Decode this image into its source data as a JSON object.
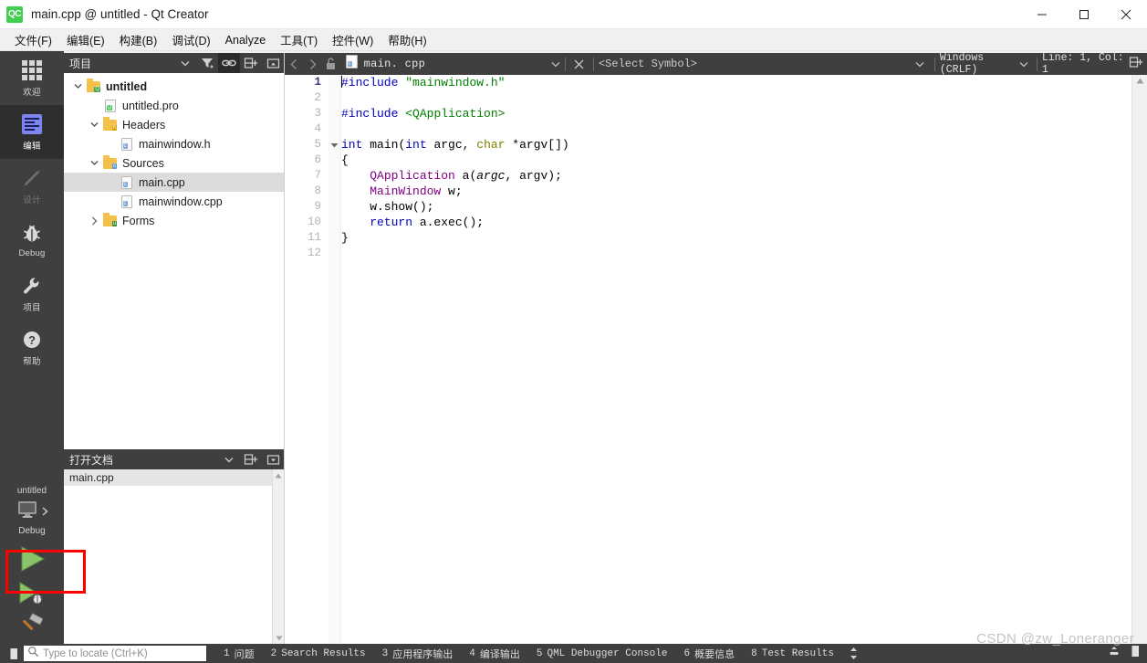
{
  "window": {
    "logo": "qtcreator-logo",
    "title": "main.cpp @ untitled - Qt Creator",
    "minimize": "minimize-icon",
    "maximize": "maximize-icon",
    "close": "close-icon"
  },
  "menubar": {
    "items": [
      {
        "label": "文件(F)",
        "mnemonic": "F"
      },
      {
        "label": "编辑(E)",
        "mnemonic": "E"
      },
      {
        "label": "构建(B)",
        "mnemonic": "B"
      },
      {
        "label": "调试(D)",
        "mnemonic": "D"
      },
      {
        "label": "Analyze",
        "mnemonic": "A"
      },
      {
        "label": "工具(T)",
        "mnemonic": "T"
      },
      {
        "label": "控件(W)",
        "mnemonic": "W"
      },
      {
        "label": "帮助(H)",
        "mnemonic": "H"
      }
    ]
  },
  "modebar": {
    "items": [
      {
        "label": "欢迎",
        "icon": "grid-icon",
        "state": "normal"
      },
      {
        "label": "编辑",
        "icon": "edit-lines-icon",
        "state": "active"
      },
      {
        "label": "设计",
        "icon": "pencil-icon",
        "state": "disabled"
      },
      {
        "label": "Debug",
        "icon": "bug-icon",
        "state": "normal"
      },
      {
        "label": "项目",
        "icon": "wrench-icon",
        "state": "normal"
      },
      {
        "label": "帮助",
        "icon": "question-mark-icon",
        "state": "normal"
      }
    ]
  },
  "kitselector": {
    "project": "untitled",
    "build_config": "Debug",
    "monitor_icon": "monitor-icon",
    "expand_icon": "chevron-right-icon",
    "run_button": "run-green-play-icon",
    "debug_button": "debug-run-icon",
    "build_button": "hammer-build-icon",
    "highlight_color": "#ff0000"
  },
  "project_panel": {
    "title": "项目",
    "tools": [
      {
        "name": "dropdown-icon",
        "label": "▾"
      },
      {
        "name": "filter-icon",
        "label": "filter"
      },
      {
        "name": "link-sync-icon",
        "label": "link"
      },
      {
        "name": "split-icon",
        "label": "split"
      },
      {
        "name": "collapse-icon",
        "label": "collapse"
      }
    ],
    "tree": [
      {
        "label": "untitled",
        "indent": 0,
        "arrow": "down",
        "icon": "folder-qt",
        "bold": true,
        "selected": false
      },
      {
        "label": "untitled.pro",
        "indent": 1,
        "arrow": "none",
        "icon": "file-pro",
        "bold": false,
        "selected": false
      },
      {
        "label": "Headers",
        "indent": 1,
        "arrow": "down",
        "icon": "folder-h",
        "bold": false,
        "selected": false
      },
      {
        "label": "mainwindow.h",
        "indent": 2,
        "arrow": "none",
        "icon": "file-h",
        "bold": false,
        "selected": false
      },
      {
        "label": "Sources",
        "indent": 1,
        "arrow": "down",
        "icon": "folder-cpp",
        "bold": false,
        "selected": false
      },
      {
        "label": "main.cpp",
        "indent": 2,
        "arrow": "none",
        "icon": "file-cpp",
        "bold": false,
        "selected": true
      },
      {
        "label": "mainwindow.cpp",
        "indent": 2,
        "arrow": "none",
        "icon": "file-cpp",
        "bold": false,
        "selected": false
      },
      {
        "label": "Forms",
        "indent": 1,
        "arrow": "right",
        "icon": "folder-ui",
        "bold": false,
        "selected": false
      }
    ]
  },
  "open_documents": {
    "title": "打开文档",
    "tools": [
      {
        "name": "dropdown-icon",
        "label": "▾"
      },
      {
        "name": "split-icon",
        "label": "split"
      },
      {
        "name": "close-panel-icon",
        "label": "close"
      }
    ],
    "items": [
      {
        "label": "main.cpp",
        "selected": true
      }
    ]
  },
  "editor_toolbar": {
    "back": "back-arrow-icon",
    "forward": "forward-arrow-icon",
    "lock": "unlocked-padlock-icon",
    "file_icon": "cpp-file-icon",
    "filename": "main. cpp",
    "file_dropdown": "chevron-down-icon",
    "close": "close-x-icon",
    "symbol_selector": "<Select Symbol>",
    "symbol_dropdown": "chevron-down-icon",
    "line_ending": "Windows (CRLF)",
    "line_ending_dropdown": "chevron-down-icon",
    "cursor_position": "Line: 1, Col: 1",
    "split_icon": "split-editor-icon"
  },
  "code": {
    "lines": [
      {
        "n": "1",
        "fold": false,
        "current": true,
        "tokens": [
          {
            "t": "caret",
            "v": ""
          },
          {
            "t": "pp",
            "v": "#include"
          },
          {
            "t": "id",
            "v": " "
          },
          {
            "t": "str",
            "v": "\"mainwindow.h\""
          }
        ]
      },
      {
        "n": "2",
        "fold": false,
        "current": false,
        "tokens": []
      },
      {
        "n": "3",
        "fold": false,
        "current": false,
        "tokens": [
          {
            "t": "pp",
            "v": "#include"
          },
          {
            "t": "id",
            "v": " "
          },
          {
            "t": "str",
            "v": "<QApplication>"
          }
        ]
      },
      {
        "n": "4",
        "fold": false,
        "current": false,
        "tokens": []
      },
      {
        "n": "5",
        "fold": true,
        "current": false,
        "tokens": [
          {
            "t": "k",
            "v": "int"
          },
          {
            "t": "id",
            "v": " "
          },
          {
            "t": "fn",
            "v": "main"
          },
          {
            "t": "id",
            "v": "("
          },
          {
            "t": "k",
            "v": "int"
          },
          {
            "t": "id",
            "v": " argc, "
          },
          {
            "t": "ol",
            "v": "char"
          },
          {
            "t": "id",
            "v": " *argv[])"
          }
        ]
      },
      {
        "n": "6",
        "fold": false,
        "current": false,
        "tokens": [
          {
            "t": "id",
            "v": "{"
          }
        ]
      },
      {
        "n": "7",
        "fold": false,
        "current": false,
        "tokens": [
          {
            "t": "id",
            "v": "    "
          },
          {
            "t": "ty",
            "v": "QApplication"
          },
          {
            "t": "id",
            "v": " a("
          },
          {
            "t": "par",
            "v": "argc"
          },
          {
            "t": "id",
            "v": ", argv);"
          }
        ]
      },
      {
        "n": "8",
        "fold": false,
        "current": false,
        "tokens": [
          {
            "t": "id",
            "v": "    "
          },
          {
            "t": "ty",
            "v": "MainWindow"
          },
          {
            "t": "id",
            "v": " w;"
          }
        ]
      },
      {
        "n": "9",
        "fold": false,
        "current": false,
        "tokens": [
          {
            "t": "id",
            "v": "    w.show();"
          }
        ]
      },
      {
        "n": "10",
        "fold": false,
        "current": false,
        "tokens": [
          {
            "t": "id",
            "v": "    "
          },
          {
            "t": "k",
            "v": "return"
          },
          {
            "t": "id",
            "v": " a.exec();"
          }
        ]
      },
      {
        "n": "11",
        "fold": false,
        "current": false,
        "tokens": [
          {
            "t": "id",
            "v": "}"
          }
        ]
      },
      {
        "n": "12",
        "fold": false,
        "current": false,
        "tokens": []
      }
    ]
  },
  "statusbar": {
    "sidebar_toggle": "sidebar-toggle-icon",
    "locator": {
      "icon": "search-icon",
      "placeholder": "Type to locate (Ctrl+K)",
      "value": ""
    },
    "output_tabs": [
      {
        "num": "1",
        "label": "问题"
      },
      {
        "num": "2",
        "label": "Search Results"
      },
      {
        "num": "3",
        "label": "应用程序输出"
      },
      {
        "num": "4",
        "label": "编译输出"
      },
      {
        "num": "5",
        "label": "QML Debugger Console"
      },
      {
        "num": "6",
        "label": "概要信息"
      },
      {
        "num": "8",
        "label": "Test Results"
      }
    ],
    "updown_icon": "up-down-arrows-icon",
    "minimize_output_icon": "minimize-output-icon",
    "panel_toggle_icon": "panel-toggle-icon"
  },
  "watermark": "CSDN @zw_Loneranger"
}
